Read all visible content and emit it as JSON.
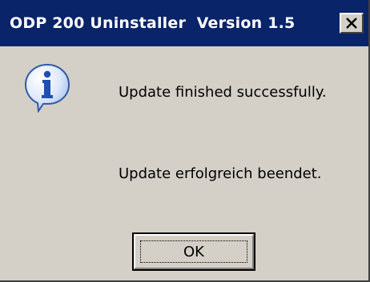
{
  "window": {
    "title": "ODP 200 Uninstaller  Version 1.5",
    "close_icon": "close-icon"
  },
  "dialog": {
    "icon": "information-icon",
    "message_en": "Update finished successfully.",
    "message_de": "Update erfolgreich beendet.",
    "ok_label": "OK"
  },
  "colors": {
    "titlebar": "#0a246a",
    "face": "#d4d0c8",
    "icon_blue": "#3a6fd0"
  }
}
